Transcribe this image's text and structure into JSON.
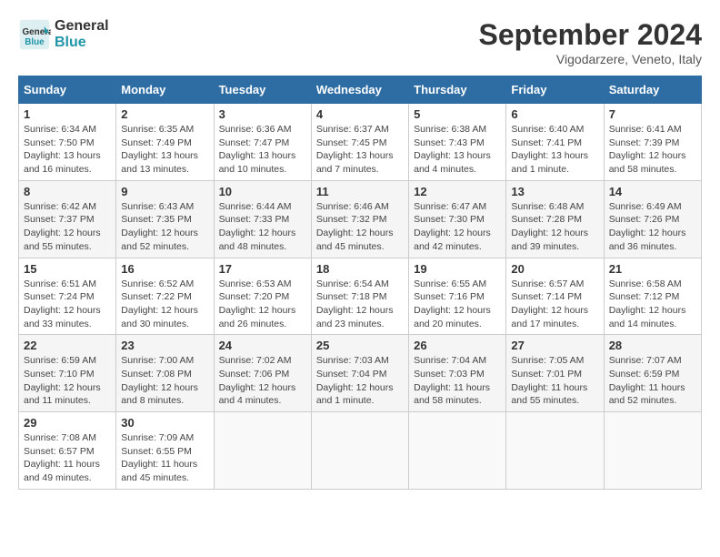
{
  "header": {
    "logo_line1": "General",
    "logo_line2": "Blue",
    "month_title": "September 2024",
    "location": "Vigodarzere, Veneto, Italy"
  },
  "days_of_week": [
    "Sunday",
    "Monday",
    "Tuesday",
    "Wednesday",
    "Thursday",
    "Friday",
    "Saturday"
  ],
  "weeks": [
    [
      {
        "day": "1",
        "sunrise": "6:34 AM",
        "sunset": "7:50 PM",
        "daylight": "13 hours and 16 minutes."
      },
      {
        "day": "2",
        "sunrise": "6:35 AM",
        "sunset": "7:49 PM",
        "daylight": "13 hours and 13 minutes."
      },
      {
        "day": "3",
        "sunrise": "6:36 AM",
        "sunset": "7:47 PM",
        "daylight": "13 hours and 10 minutes."
      },
      {
        "day": "4",
        "sunrise": "6:37 AM",
        "sunset": "7:45 PM",
        "daylight": "13 hours and 7 minutes."
      },
      {
        "day": "5",
        "sunrise": "6:38 AM",
        "sunset": "7:43 PM",
        "daylight": "13 hours and 4 minutes."
      },
      {
        "day": "6",
        "sunrise": "6:40 AM",
        "sunset": "7:41 PM",
        "daylight": "13 hours and 1 minute."
      },
      {
        "day": "7",
        "sunrise": "6:41 AM",
        "sunset": "7:39 PM",
        "daylight": "12 hours and 58 minutes."
      }
    ],
    [
      {
        "day": "8",
        "sunrise": "6:42 AM",
        "sunset": "7:37 PM",
        "daylight": "12 hours and 55 minutes."
      },
      {
        "day": "9",
        "sunrise": "6:43 AM",
        "sunset": "7:35 PM",
        "daylight": "12 hours and 52 minutes."
      },
      {
        "day": "10",
        "sunrise": "6:44 AM",
        "sunset": "7:33 PM",
        "daylight": "12 hours and 48 minutes."
      },
      {
        "day": "11",
        "sunrise": "6:46 AM",
        "sunset": "7:32 PM",
        "daylight": "12 hours and 45 minutes."
      },
      {
        "day": "12",
        "sunrise": "6:47 AM",
        "sunset": "7:30 PM",
        "daylight": "12 hours and 42 minutes."
      },
      {
        "day": "13",
        "sunrise": "6:48 AM",
        "sunset": "7:28 PM",
        "daylight": "12 hours and 39 minutes."
      },
      {
        "day": "14",
        "sunrise": "6:49 AM",
        "sunset": "7:26 PM",
        "daylight": "12 hours and 36 minutes."
      }
    ],
    [
      {
        "day": "15",
        "sunrise": "6:51 AM",
        "sunset": "7:24 PM",
        "daylight": "12 hours and 33 minutes."
      },
      {
        "day": "16",
        "sunrise": "6:52 AM",
        "sunset": "7:22 PM",
        "daylight": "12 hours and 30 minutes."
      },
      {
        "day": "17",
        "sunrise": "6:53 AM",
        "sunset": "7:20 PM",
        "daylight": "12 hours and 26 minutes."
      },
      {
        "day": "18",
        "sunrise": "6:54 AM",
        "sunset": "7:18 PM",
        "daylight": "12 hours and 23 minutes."
      },
      {
        "day": "19",
        "sunrise": "6:55 AM",
        "sunset": "7:16 PM",
        "daylight": "12 hours and 20 minutes."
      },
      {
        "day": "20",
        "sunrise": "6:57 AM",
        "sunset": "7:14 PM",
        "daylight": "12 hours and 17 minutes."
      },
      {
        "day": "21",
        "sunrise": "6:58 AM",
        "sunset": "7:12 PM",
        "daylight": "12 hours and 14 minutes."
      }
    ],
    [
      {
        "day": "22",
        "sunrise": "6:59 AM",
        "sunset": "7:10 PM",
        "daylight": "12 hours and 11 minutes."
      },
      {
        "day": "23",
        "sunrise": "7:00 AM",
        "sunset": "7:08 PM",
        "daylight": "12 hours and 8 minutes."
      },
      {
        "day": "24",
        "sunrise": "7:02 AM",
        "sunset": "7:06 PM",
        "daylight": "12 hours and 4 minutes."
      },
      {
        "day": "25",
        "sunrise": "7:03 AM",
        "sunset": "7:04 PM",
        "daylight": "12 hours and 1 minute."
      },
      {
        "day": "26",
        "sunrise": "7:04 AM",
        "sunset": "7:03 PM",
        "daylight": "11 hours and 58 minutes."
      },
      {
        "day": "27",
        "sunrise": "7:05 AM",
        "sunset": "7:01 PM",
        "daylight": "11 hours and 55 minutes."
      },
      {
        "day": "28",
        "sunrise": "7:07 AM",
        "sunset": "6:59 PM",
        "daylight": "11 hours and 52 minutes."
      }
    ],
    [
      {
        "day": "29",
        "sunrise": "7:08 AM",
        "sunset": "6:57 PM",
        "daylight": "11 hours and 49 minutes."
      },
      {
        "day": "30",
        "sunrise": "7:09 AM",
        "sunset": "6:55 PM",
        "daylight": "11 hours and 45 minutes."
      },
      null,
      null,
      null,
      null,
      null
    ]
  ]
}
